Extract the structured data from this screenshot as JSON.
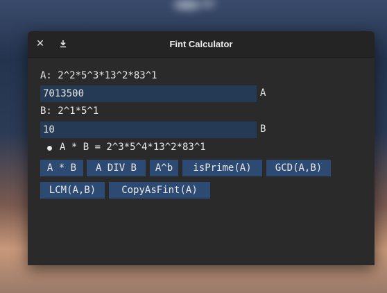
{
  "window": {
    "title": "Fint Calculator",
    "close_glyph": "✕",
    "download_glyph": "⤓"
  },
  "a": {
    "factor_line": "A: 2^2*5^3*13^2*83^1",
    "value": "7013500",
    "label": "A"
  },
  "b": {
    "factor_line": "B: 2^1*5^1",
    "value": "10",
    "label": "B"
  },
  "result": {
    "text": "A * B = 2^3*5^4*13^2*83^1"
  },
  "buttons": [
    {
      "label": "A * B"
    },
    {
      "label": "A DIV B"
    },
    {
      "label": "A^b"
    },
    {
      "label": "isPrime(A)"
    },
    {
      "label": "GCD(A,B)"
    },
    {
      "label": "LCM(A,B)"
    },
    {
      "label": "CopyAsFint(A)"
    }
  ],
  "colors": {
    "field_bg": "#253a55",
    "button_bg": "#2d4a72",
    "window_bg": "#2a2a2a",
    "titlebar_bg": "#242424"
  }
}
